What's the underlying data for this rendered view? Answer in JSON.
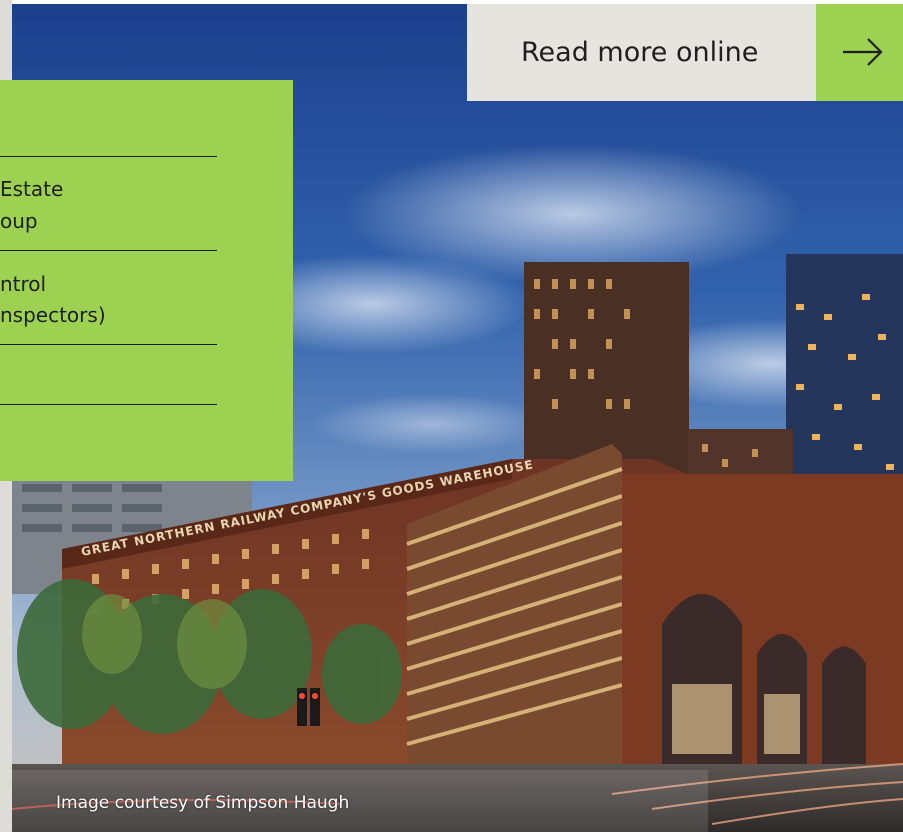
{
  "info_card": {
    "lines": [
      "Estate",
      "oup",
      "ntrol",
      "nspectors)"
    ]
  },
  "cta": {
    "label": "Read more online",
    "icon": "arrow-right-icon"
  },
  "photo": {
    "sign_text": "GREAT NORTHERN RAILWAY COMPANY'S GOODS WAREHOUSE",
    "caption": "Image courtesy of Simpson Haugh"
  },
  "colors": {
    "accent_green": "#9dd151",
    "cta_background": "#e6e4df",
    "text_dark": "#1e1e1e",
    "strip_grey": "#dedcd6"
  }
}
